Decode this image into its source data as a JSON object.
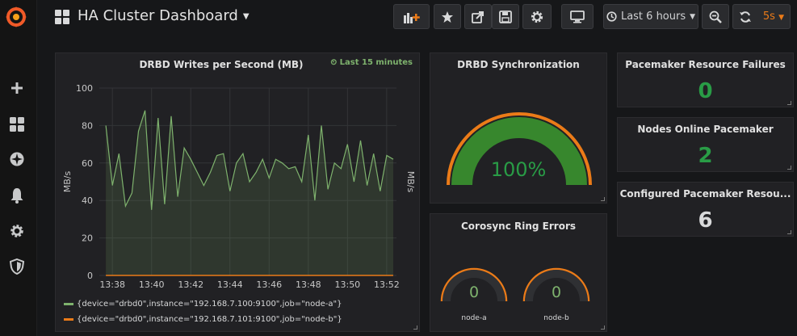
{
  "app": {
    "dashboard_title": "HA Cluster Dashboard",
    "time_range_label": "Last 6 hours",
    "refresh_label": "5s"
  },
  "colors": {
    "accent": "#eb7b18",
    "green": "#299c46",
    "gauge_green": "#37872d",
    "series_a": "#7eb26d",
    "series_b": "#eab839"
  },
  "sidebar": {
    "items": [
      {
        "name": "plus-icon"
      },
      {
        "name": "dashboards-icon"
      },
      {
        "name": "compass-icon"
      },
      {
        "name": "bell-icon"
      },
      {
        "name": "gear-icon"
      },
      {
        "name": "shield-icon"
      }
    ]
  },
  "toolbar": {
    "buttons": [
      "add-panel-icon",
      "star-icon",
      "share-icon",
      "save-icon",
      "settings-icon",
      "tv-icon",
      "zoom-out-icon",
      "refresh-icon"
    ]
  },
  "panels": {
    "drbd_writes": {
      "title": "DRBD Writes per Second (MB)",
      "time_info": "Last 15 minutes",
      "y_unit": "MB/s",
      "legend": [
        "{device=\"drbd0\",instance=\"192.168.7.100:9100\",job=\"node-a\"}",
        "{device=\"drbd0\",instance=\"192.168.7.101:9100\",job=\"node-b\"}"
      ]
    },
    "drbd_sync": {
      "title": "DRBD Synchronization",
      "value": "100%"
    },
    "corosync": {
      "title": "Corosync Ring Errors",
      "gauges": [
        {
          "label": "node-a",
          "value": "0"
        },
        {
          "label": "node-b",
          "value": "0"
        }
      ]
    },
    "resource_failures": {
      "title": "Pacemaker Resource Failures",
      "value": "0"
    },
    "nodes_online": {
      "title": "Nodes Online Pacemaker",
      "value": "2"
    },
    "configured_resources": {
      "title": "Configured Pacemaker Resou...",
      "value": "6"
    }
  },
  "chart_data": {
    "type": "line",
    "title": "DRBD Writes per Second (MB)",
    "ylabel": "MB/s",
    "ylim": [
      0,
      100
    ],
    "yticks": [
      0,
      20,
      40,
      60,
      80,
      100
    ],
    "xlim_minutes": [
      13.617,
      13.883
    ],
    "xticks": [
      "13:38",
      "13:40",
      "13:42",
      "13:44",
      "13:46",
      "13:48",
      "13:50",
      "13:52"
    ],
    "grid": true,
    "legend_position": "bottom",
    "series": [
      {
        "name": "{device=\"drbd0\",instance=\"192.168.7.100:9100\",job=\"node-a\"}",
        "color": "#7eb26d",
        "fill": true,
        "x": [
          "13:37:40",
          "13:38:00",
          "13:38:20",
          "13:38:40",
          "13:39:00",
          "13:39:20",
          "13:39:40",
          "13:40:00",
          "13:40:20",
          "13:40:40",
          "13:41:00",
          "13:41:20",
          "13:41:40",
          "13:42:00",
          "13:42:20",
          "13:42:40",
          "13:43:00",
          "13:43:20",
          "13:43:40",
          "13:44:00",
          "13:44:20",
          "13:44:40",
          "13:45:00",
          "13:45:20",
          "13:45:40",
          "13:46:00",
          "13:46:20",
          "13:46:40",
          "13:47:00",
          "13:47:20",
          "13:47:40",
          "13:48:00",
          "13:48:20",
          "13:48:40",
          "13:49:00",
          "13:49:20",
          "13:49:40",
          "13:50:00",
          "13:50:20",
          "13:50:40",
          "13:51:00",
          "13:51:20",
          "13:51:40",
          "13:52:00",
          "13:52:20"
        ],
        "values": [
          80,
          48,
          65,
          37,
          44,
          77,
          88,
          35,
          84,
          38,
          85,
          42,
          68,
          62,
          55,
          48,
          55,
          64,
          65,
          45,
          60,
          65,
          50,
          55,
          62,
          52,
          62,
          60,
          57,
          58,
          50,
          75,
          40,
          80,
          46,
          60,
          57,
          70,
          50,
          72,
          48,
          65,
          45,
          64,
          62
        ]
      },
      {
        "name": "{device=\"drbd0\",instance=\"192.168.7.101:9100\",job=\"node-b\"}",
        "color": "#eab839",
        "fill": false,
        "x": [
          "13:37:40",
          "13:52:20"
        ],
        "values": [
          0,
          0
        ]
      }
    ]
  }
}
